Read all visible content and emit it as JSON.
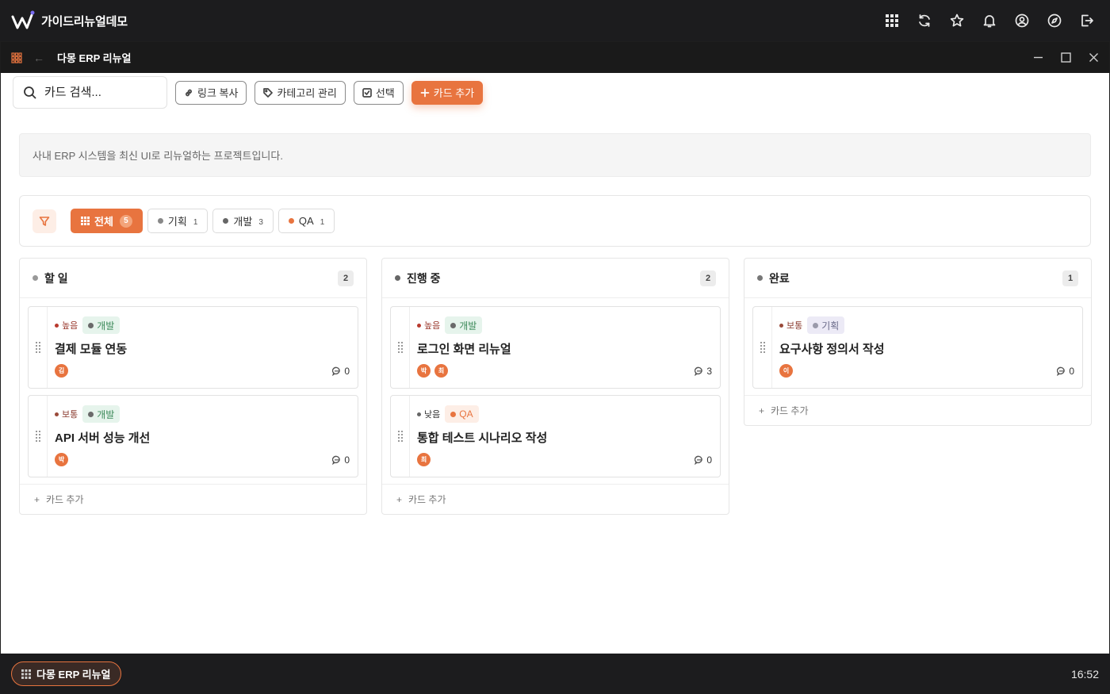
{
  "os": {
    "brand": "가이드리뉴얼데모",
    "top_icons": [
      "apps-grid-icon",
      "refresh-icon",
      "star-icon",
      "bell-icon",
      "user-icon",
      "compass-icon",
      "logout-icon"
    ],
    "clock": "16:52"
  },
  "window": {
    "title": "다몽 ERP 리뉴얼",
    "back_arrow": "←"
  },
  "toolbar": {
    "search_placeholder": "카드 검색...",
    "copy_link": "링크 복사",
    "manage_categories": "카테고리 관리",
    "select": "선택",
    "add_card": "카드 추가"
  },
  "description": "사내 ERP 시스템을 최신 UI로 리뉴얼하는 프로젝트입니다.",
  "filters": [
    {
      "label": "전체",
      "count": "5",
      "active": true
    },
    {
      "label": "기획",
      "count": "1",
      "color": "#888888"
    },
    {
      "label": "개발",
      "count": "3",
      "color": "#666666"
    },
    {
      "label": "QA",
      "count": "1",
      "color": "#e8743f"
    }
  ],
  "columns": [
    {
      "title": "할 일",
      "count": "2",
      "cards": [
        {
          "priority": "높음",
          "category": "개발",
          "title": "결제 모듈 연동",
          "avatars": [
            "김"
          ],
          "comments": "0"
        },
        {
          "priority": "보통",
          "category": "개발",
          "title": "API 서버 성능 개선",
          "avatars": [
            "박"
          ],
          "comments": "0"
        }
      ],
      "add_label": "카드 추가"
    },
    {
      "title": "진행 중",
      "count": "2",
      "cards": [
        {
          "priority": "높음",
          "category": "개발",
          "title": "로그인 화면 리뉴얼",
          "avatars": [
            "박",
            "최"
          ],
          "comments": "3"
        },
        {
          "priority": "낮음",
          "category": "QA",
          "title": "통합 테스트 시나리오 작성",
          "avatars": [
            "최"
          ],
          "comments": "0"
        }
      ],
      "add_label": "카드 추가"
    },
    {
      "title": "완료",
      "count": "1",
      "cards": [
        {
          "priority": "보통",
          "category": "기획",
          "title": "요구사항 정의서 작성",
          "avatars": [
            "이"
          ],
          "comments": "0"
        }
      ],
      "add_label": "카드 추가"
    }
  ],
  "taskbar": {
    "active_app": "다몽 ERP 리뉴얼"
  },
  "colors": {
    "accent": "#e8743f",
    "priority_high": "#b83a2e",
    "priority_normal": "#9a4a3a",
    "priority_low": "#666666",
    "cat_dev_bg": "#e6f4ec",
    "cat_dev_text": "#3d8a5a",
    "cat_plan_bg": "#eceaf6",
    "cat_plan_text": "#6b6b8a",
    "cat_qa_bg": "#fdeee6",
    "cat_qa_text": "#e8743f"
  }
}
